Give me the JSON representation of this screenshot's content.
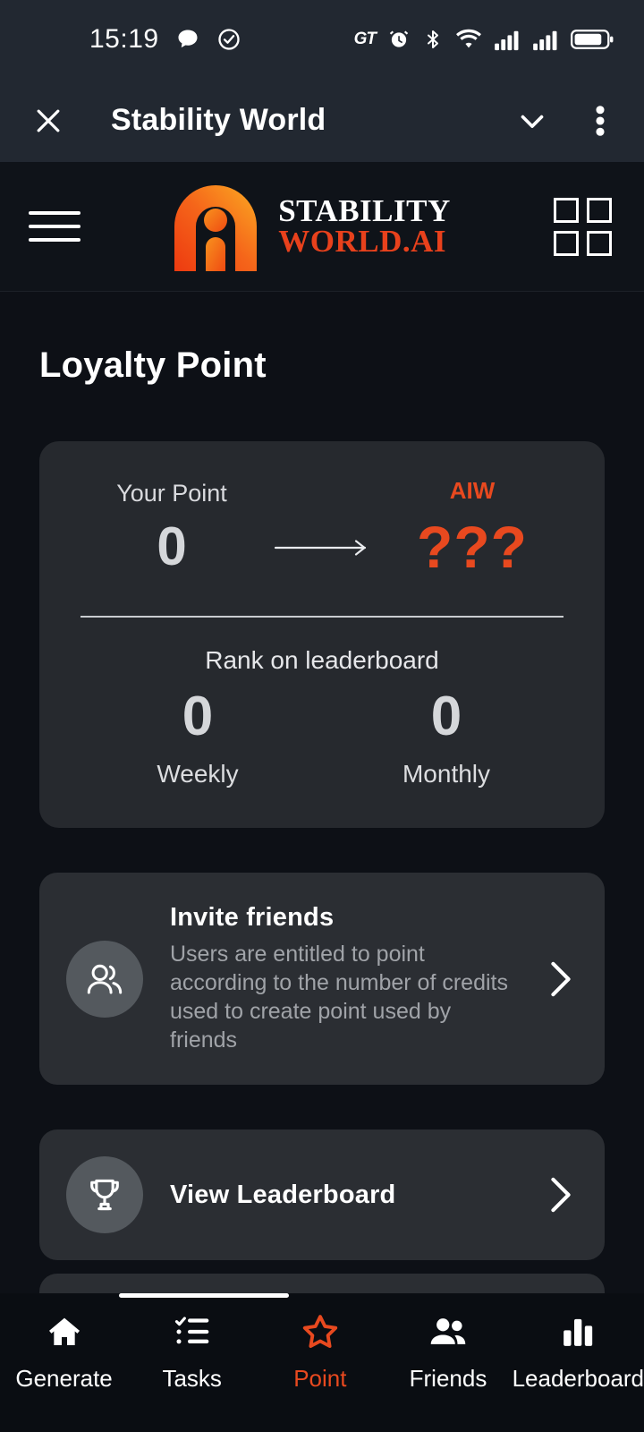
{
  "status_bar": {
    "time": "15:19",
    "left_icons": [
      "chat-bubble-icon",
      "check-circle-icon"
    ],
    "right_icons": [
      "gt-badge",
      "alarm-icon",
      "bluetooth-icon",
      "wifi-icon",
      "signal-icon-1",
      "signal-icon-2",
      "battery-icon"
    ],
    "gt_label": "GT"
  },
  "app_bar": {
    "title": "Stability World",
    "close_icon": "close-icon",
    "chevron_icon": "chevron-down-icon",
    "overflow_icon": "more-vertical-icon"
  },
  "brand_header": {
    "menu_icon": "hamburger-menu-icon",
    "logo_icon": "stability-world-logo-icon",
    "brand_line1": "STABILITY",
    "brand_line2": "WORLD.AI",
    "grid_icon": "grid-apps-icon",
    "brand_accent": "#e8411c"
  },
  "main": {
    "page_title": "Loyalty Point",
    "points_card": {
      "your_point_label": "Your Point",
      "your_point_value": "0",
      "arrow_icon": "arrow-right-icon",
      "token_label": "AIW",
      "token_value": "???",
      "token_color": "#e8491f",
      "rank_title": "Rank on leaderboard",
      "ranks": [
        {
          "value": "0",
          "label": "Weekly"
        },
        {
          "value": "0",
          "label": "Monthly"
        }
      ]
    },
    "invite_card": {
      "icon": "two-people-icon",
      "title": "Invite friends",
      "description": "Users are entitled to point according to the number of credits used to create point used by friends",
      "chevron": "chevron-right-icon"
    },
    "leaderboard_card": {
      "icon": "trophy-icon",
      "title": "View Leaderboard",
      "chevron": "chevron-right-icon"
    }
  },
  "bottom_nav": {
    "active": "Point",
    "accent": "#e8491f",
    "items": [
      {
        "label": "Generate",
        "icon": "home-icon"
      },
      {
        "label": "Tasks",
        "icon": "checklist-icon"
      },
      {
        "label": "Point",
        "icon": "star-icon"
      },
      {
        "label": "Friends",
        "icon": "people-icon"
      },
      {
        "label": "Leaderboard",
        "icon": "bar-chart-icon"
      }
    ]
  }
}
